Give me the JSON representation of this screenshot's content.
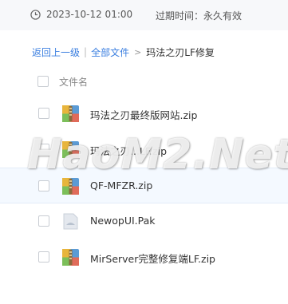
{
  "meta": {
    "timestamp": "2023-10-12 01:00",
    "expire_label": "过期时间：永久有效"
  },
  "breadcrumb": {
    "back": "返回上一级",
    "separator": "|",
    "all_files": "全部文件",
    "arrow": ">",
    "current": "玛法之刃LF修复"
  },
  "list": {
    "header": "文件名",
    "files": [
      {
        "name": "玛法之刃最终版网站.zip",
        "icon": "zip-archive-icon"
      },
      {
        "name": "玛法之刃...LF.zip",
        "icon": "zip-archive-icon"
      },
      {
        "name": "QF-MFZR.zip",
        "icon": "zip-archive-icon"
      },
      {
        "name": "NewopUI.Pak",
        "icon": "generic-file-icon"
      },
      {
        "name": "MirServer完整修复端LF.zip",
        "icon": "zip-archive-icon"
      }
    ]
  },
  "watermark": "HaoM2.Net",
  "colors": {
    "link": "#3b7fe0",
    "meta_bg": "#f7f8fa",
    "row_highlight": "#f4f9ff"
  }
}
